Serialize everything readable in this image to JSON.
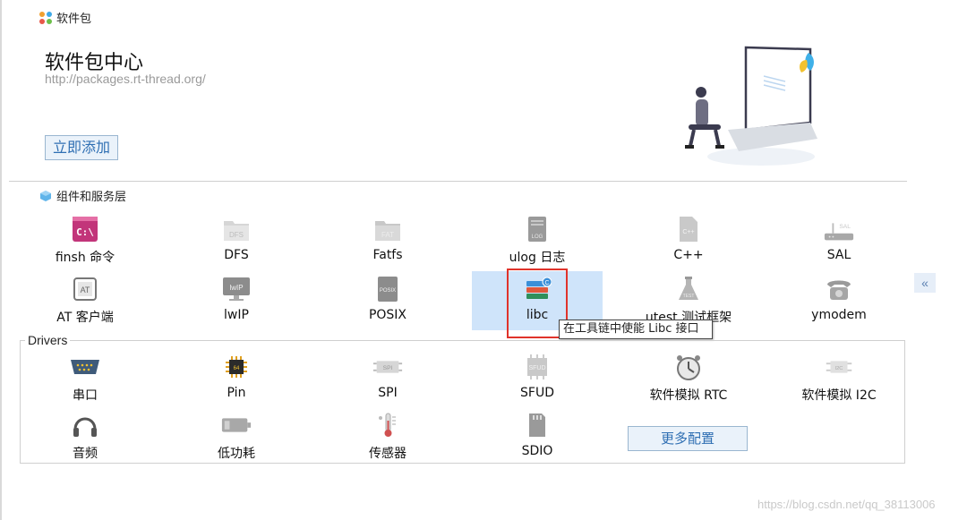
{
  "header": {
    "title": "软件包"
  },
  "center": {
    "title": "软件包中心",
    "url": "http://packages.rt-thread.org/",
    "add_button": "立即添加"
  },
  "section": {
    "title": "组件和服务层"
  },
  "components": [
    {
      "label": "finsh 命令",
      "icon": "terminal-icon"
    },
    {
      "label": "DFS",
      "icon": "dfs-folder-icon"
    },
    {
      "label": "Fatfs",
      "icon": "fat-folder-icon"
    },
    {
      "label": "ulog 日志",
      "icon": "log-file-icon"
    },
    {
      "label": "C++",
      "icon": "cpp-file-icon"
    },
    {
      "label": "SAL",
      "icon": "router-icon"
    },
    {
      "label": "AT 客户端",
      "icon": "at-device-icon"
    },
    {
      "label": "lwIP",
      "icon": "lwip-monitor-icon"
    },
    {
      "label": "POSIX",
      "icon": "posix-doc-icon"
    },
    {
      "label": "libc",
      "icon": "books-icon",
      "selected": true
    },
    {
      "label": "utest 测试框架",
      "icon": "flask-icon"
    },
    {
      "label": "ymodem",
      "icon": "telephone-icon"
    }
  ],
  "tooltip": "在工具链中使能 Libc 接口",
  "drivers": {
    "title": "Drivers",
    "items": [
      {
        "label": "串口",
        "icon": "serial-port-icon"
      },
      {
        "label": "Pin",
        "icon": "chip-icon"
      },
      {
        "label": "SPI",
        "icon": "spi-icon"
      },
      {
        "label": "SFUD",
        "icon": "sfud-chip-icon"
      },
      {
        "label": "软件模拟 RTC",
        "icon": "clock-icon"
      },
      {
        "label": "软件模拟 I2C",
        "icon": "i2c-icon"
      },
      {
        "label": "音频",
        "icon": "headphones-icon"
      },
      {
        "label": "低功耗",
        "icon": "battery-icon"
      },
      {
        "label": "传感器",
        "icon": "thermometer-icon"
      },
      {
        "label": "SDIO",
        "icon": "sd-card-icon"
      }
    ],
    "more_button": "更多配置"
  },
  "collapse_button": "«",
  "watermark": "https://blog.csdn.net/qq_38113006",
  "colors": {
    "accent": "#2f6fb3",
    "selected_bg": "#cfe4fa",
    "highlight_border": "#e0332b"
  }
}
